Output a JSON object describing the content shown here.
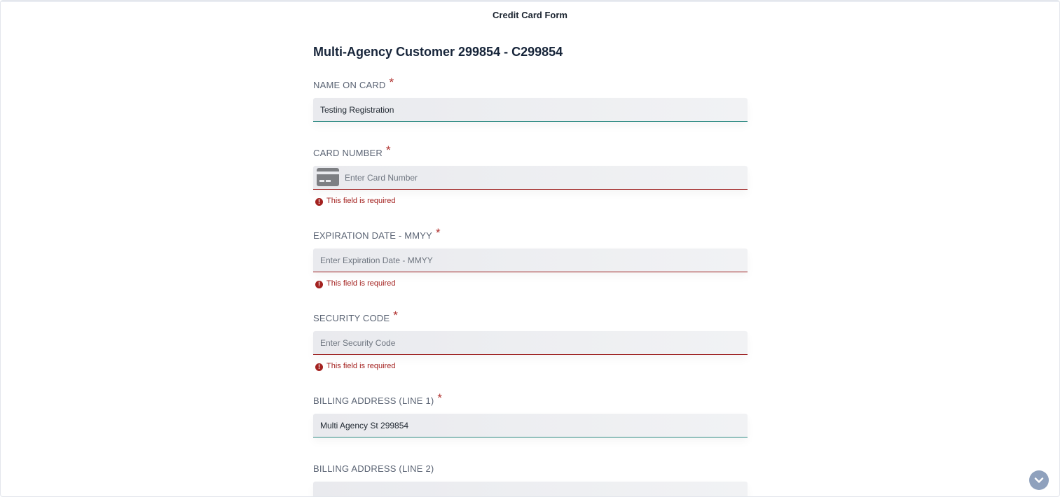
{
  "header": {
    "title": "Credit Card Form"
  },
  "form": {
    "customer_heading": "Multi-Agency Customer 299854 - C299854",
    "required_marker": "*",
    "error_text": "This field is required",
    "fields": {
      "name_on_card": {
        "label": "NAME ON CARD",
        "value": "Testing Registration",
        "required": true
      },
      "card_number": {
        "label": "CARD NUMBER",
        "placeholder": "Enter Card Number",
        "required": true,
        "error": true,
        "icon": "credit-card-icon"
      },
      "expiration": {
        "label": "EXPIRATION DATE - MMYY",
        "placeholder": "Enter Expiration Date - MMYY",
        "required": true,
        "error": true
      },
      "security_code": {
        "label": "SECURITY CODE",
        "placeholder": "Enter Security Code",
        "required": true,
        "error": true
      },
      "billing_line1": {
        "label": "BILLING ADDRESS (LINE 1)",
        "value": "Multi Agency St 299854",
        "required": true
      },
      "billing_line2": {
        "label": "BILLING ADDRESS (LINE 2)",
        "value": "",
        "required": false
      }
    }
  },
  "icons": {
    "error_icon": "exclamation-circle-icon",
    "scroll_icon": "chevron-down-icon"
  },
  "colors": {
    "title_text": "#1b2430",
    "label_text": "#5b6474",
    "required_star": "#b0322f",
    "error": "#a3211f",
    "valid_underline": "#2e8a83",
    "input_bg": "#eceef1",
    "scroll_button": "#8fa1bd"
  }
}
